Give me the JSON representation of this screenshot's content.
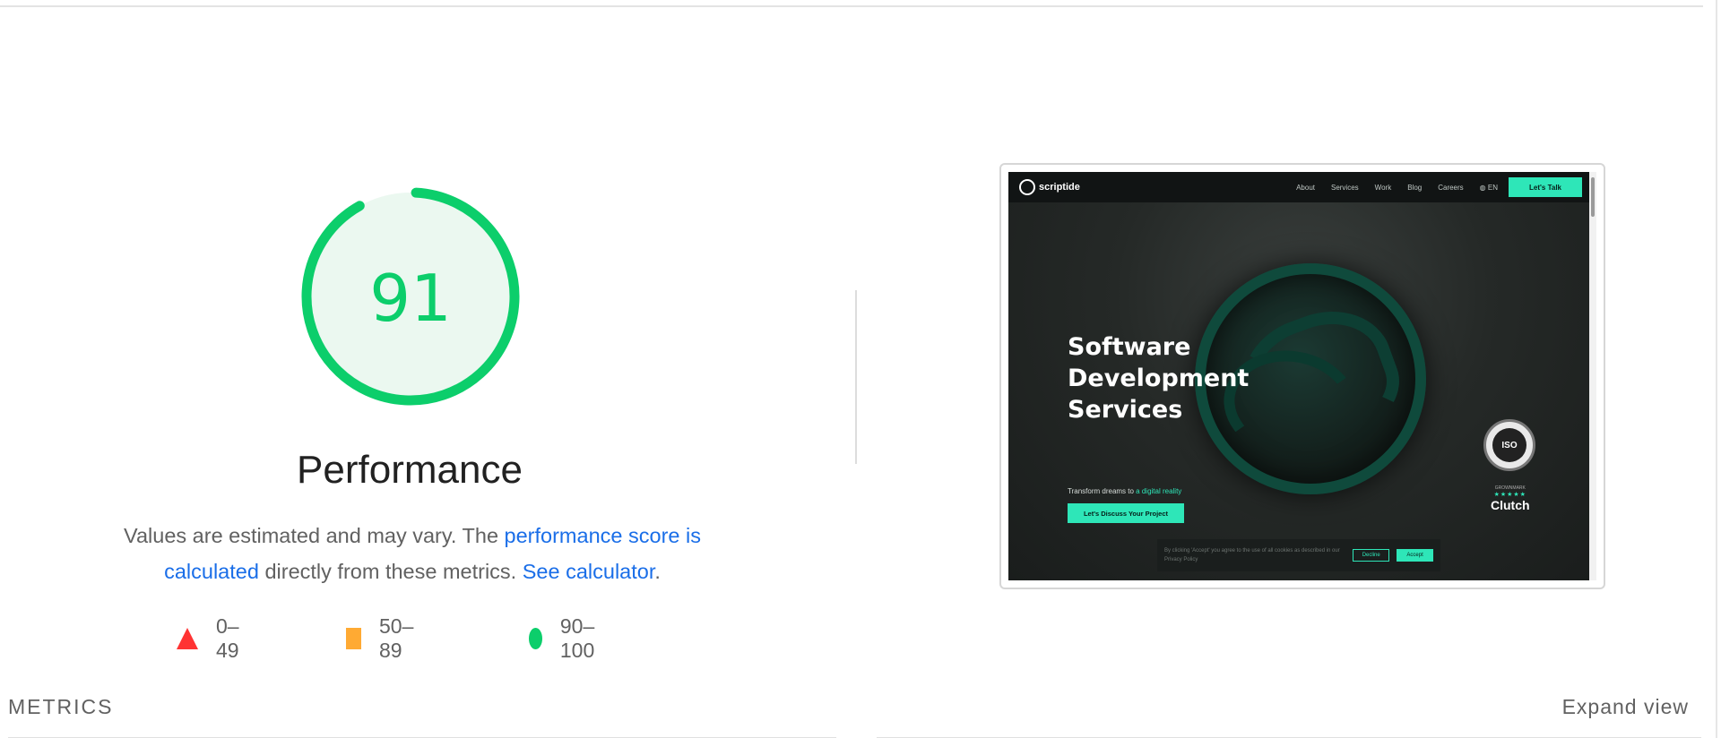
{
  "score": {
    "value": "91",
    "fraction": 0.91,
    "category": "Performance",
    "color": "#0cce6b",
    "background": "#ebf8f0"
  },
  "description": {
    "part1": "Values are estimated and may vary. The ",
    "link1": "performance score is calculated",
    "part2": " directly from these metrics. ",
    "link2": "See calculator",
    "part3": "."
  },
  "legend": [
    {
      "icon": "red-triangle-icon",
      "range": "0–49",
      "color": "#ff3333"
    },
    {
      "icon": "orange-square-icon",
      "range": "50–89",
      "color": "#ffaa33"
    },
    {
      "icon": "green-circle-icon",
      "range": "90–100",
      "color": "#0cce6b"
    }
  ],
  "thumbnail": {
    "logo": "scriptide",
    "nav": [
      "About",
      "Services",
      "Work",
      "Blog",
      "Careers",
      "EN"
    ],
    "cta": "Let's Talk",
    "hero_lines": [
      "Software",
      "Development",
      "Services"
    ],
    "hero_sub_a": "Transform dreams to ",
    "hero_sub_b": "a digital reality",
    "hero_button": "Let's Discuss Your Project",
    "badge": "ISO",
    "clutch_small": "GROWNMARK",
    "clutch_stars": "★★★★★",
    "clutch_name": "Clutch",
    "cookie_text": "By clicking 'Accept' you agree to the use of all cookies as described in our Privacy Policy",
    "cookie_decline": "Decline",
    "cookie_accept": "Accept",
    "accent": "#2ee6b8"
  },
  "metrics": {
    "title": "METRICS",
    "expand": "Expand view"
  }
}
